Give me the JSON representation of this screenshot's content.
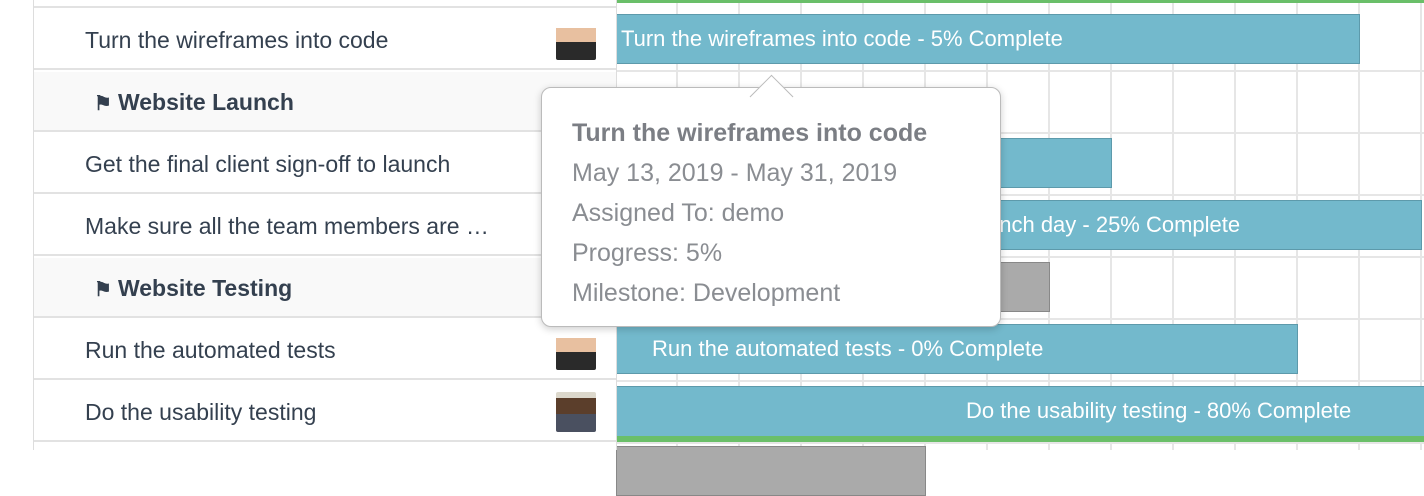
{
  "rows": [
    {
      "name": "Turn the wireframes into code",
      "avatar": "male",
      "bar_label": "Turn the wireframes into code - 5% Complete",
      "bar_label_visible": "e wireframes into code - 5% Complete"
    },
    {
      "name": "Website Launch",
      "milestone": true,
      "icon": "flag-icon"
    },
    {
      "name": "Get the final client sign-off to launch"
    },
    {
      "name": "Make sure all the team members are …",
      "bar_label_visible": "unch day - 25% Complete"
    },
    {
      "name": "Website Testing",
      "milestone": true,
      "icon": "flag-icon"
    },
    {
      "name": "Run the automated tests",
      "avatar": "male",
      "bar_label": "Run the automated tests - 0% Complete"
    },
    {
      "name": "Do the usability testing",
      "avatar": "female",
      "bar_label": "Do the usability testing - 80% Complete"
    }
  ],
  "tooltip": {
    "title": "Turn the wireframes into code",
    "dates": "May 13, 2019 - May 31, 2019",
    "assigned": "Assigned To: demo",
    "progress": "Progress: 5%",
    "milestone": "Milestone: Development"
  },
  "colors": {
    "task_bar": "#73b9cc",
    "milestone_bar": "#aaaaaa",
    "progress_line": "#6abf69"
  }
}
